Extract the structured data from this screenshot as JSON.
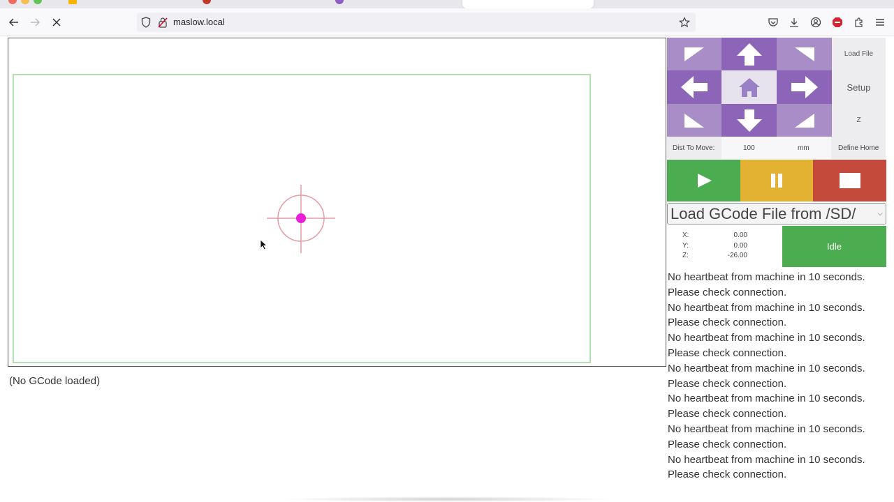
{
  "browser": {
    "address": "maslow.local"
  },
  "gcode_status": "(No GCode loaded)",
  "side_buttons": {
    "load_file": "Load File",
    "setup": "Setup",
    "z": "Z",
    "define_home": "Define Home"
  },
  "distance": {
    "label": "Dist To Move:",
    "value": "100",
    "unit": "mm"
  },
  "file_select": {
    "selected": "Load GCode File from /SD/"
  },
  "position": {
    "x_label": "X:",
    "x_value": "0.00",
    "y_label": "Y:",
    "y_value": "0.00",
    "z_label": "Z:",
    "z_value": "-26.00"
  },
  "machine_state": "Idle",
  "log": [
    "No heartbeat from machine in 10 seconds.",
    "Please check connection.",
    "No heartbeat from machine in 10 seconds.",
    "Please check connection.",
    "No heartbeat from machine in 10 seconds.",
    "Please check connection.",
    "No heartbeat from machine in 10 seconds.",
    "Please check connection.",
    "No heartbeat from machine in 10 seconds.",
    "Please check connection.",
    "No heartbeat from machine in 10 seconds.",
    "Please check connection.",
    "No heartbeat from machine in 10 seconds.",
    "Please check connection."
  ],
  "colors": {
    "jog_dark": "#8c64b8",
    "jog_light": "#a98dc7",
    "play": "#4cad50",
    "pause": "#e4b232",
    "stop": "#c44a3c",
    "idle": "#4cad50",
    "work_area_border": "#b3dfb0",
    "crosshair": "#e89aa6",
    "position_dot": "#e81fd4"
  },
  "icons": {
    "jog_up_left": "arrow-up-left-icon",
    "jog_up": "arrow-up-icon",
    "jog_up_right": "arrow-up-right-icon",
    "jog_left": "arrow-left-icon",
    "jog_home": "home-icon",
    "jog_right": "arrow-right-icon",
    "jog_down_left": "arrow-down-left-icon",
    "jog_down": "arrow-down-icon",
    "jog_down_right": "arrow-down-right-icon",
    "play": "play-icon",
    "pause": "pause-icon",
    "stop": "stop-icon"
  }
}
